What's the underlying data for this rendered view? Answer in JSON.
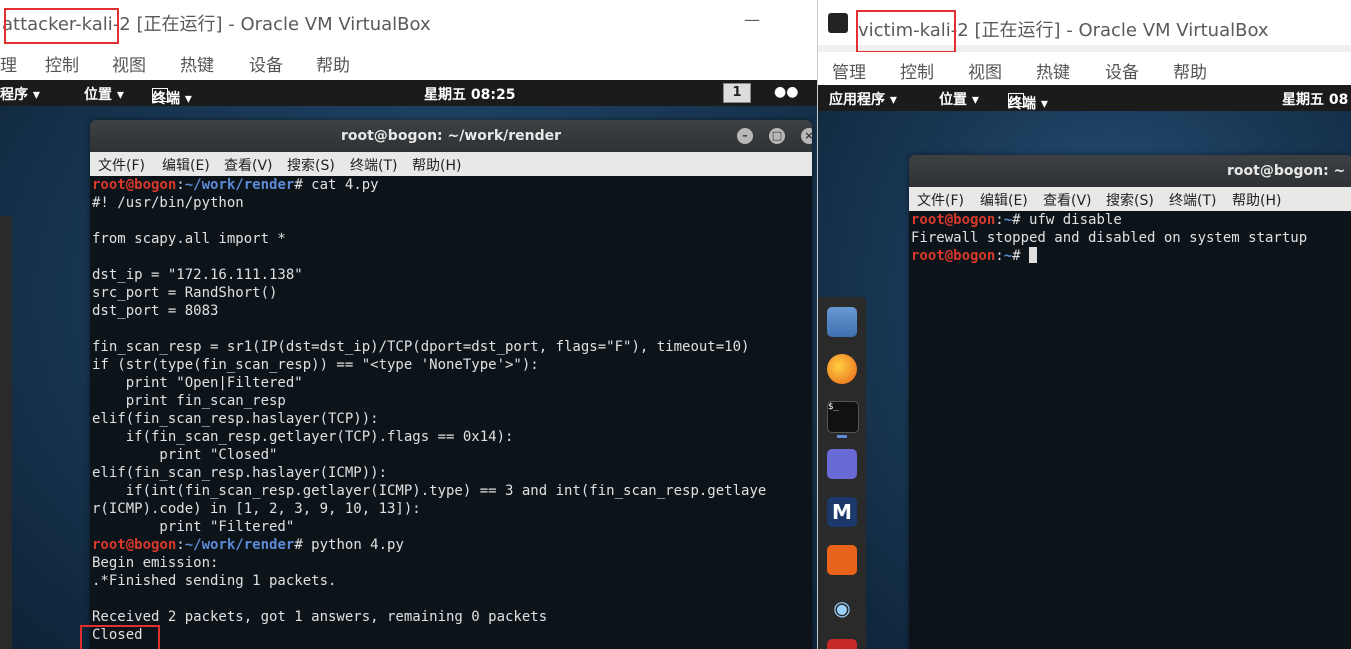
{
  "attacker": {
    "title_name": "attacker-kali-2",
    "title_rest": " [正在运行] - Oracle VM VirtualBox",
    "menu": [
      "理",
      "控制",
      "视图",
      "热键",
      "设备",
      "帮助"
    ],
    "panel": {
      "apps": "程序 ▾",
      "places": "位置 ▾",
      "terminal": "终端 ▾",
      "clock": "星期五 08:25",
      "workspace": "1"
    },
    "terminal": {
      "title": "root@bogon: ~/work/render",
      "menu": [
        "文件(F)",
        "编辑(E)",
        "查看(V)",
        "搜索(S)",
        "终端(T)",
        "帮助(H)"
      ],
      "lines": [
        {
          "prompt": true,
          "user": "root@bogon",
          "path": "~/work/render",
          "cmd": "# cat 4.py"
        },
        {
          "text": "#! /usr/bin/python"
        },
        {
          "text": ""
        },
        {
          "text": "from scapy.all import *"
        },
        {
          "text": ""
        },
        {
          "text": "dst_ip = \"172.16.111.138\""
        },
        {
          "text": "src_port = RandShort()"
        },
        {
          "text": "dst_port = 8083"
        },
        {
          "text": ""
        },
        {
          "text": "fin_scan_resp = sr1(IP(dst=dst_ip)/TCP(dport=dst_port, flags=\"F\"), timeout=10)"
        },
        {
          "text": "if (str(type(fin_scan_resp)) == \"<type 'NoneType'>\"):"
        },
        {
          "text": "    print \"Open|Filtered\""
        },
        {
          "text": "    print fin_scan_resp"
        },
        {
          "text": "elif(fin_scan_resp.haslayer(TCP)):"
        },
        {
          "text": "    if(fin_scan_resp.getlayer(TCP).flags == 0x14):"
        },
        {
          "text": "        print \"Closed\""
        },
        {
          "text": "elif(fin_scan_resp.haslayer(ICMP)):"
        },
        {
          "text": "    if(int(fin_scan_resp.getlayer(ICMP).type) == 3 and int(fin_scan_resp.getlaye"
        },
        {
          "text": "r(ICMP).code) in [1, 2, 3, 9, 10, 13]):"
        },
        {
          "text": "        print \"Filtered\""
        },
        {
          "prompt": true,
          "user": "root@bogon",
          "path": "~/work/render",
          "cmd": "# python 4.py"
        },
        {
          "text": "Begin emission:"
        },
        {
          "text": ".*Finished sending 1 packets."
        },
        {
          "text": ""
        },
        {
          "text": "Received 2 packets, got 1 answers, remaining 0 packets"
        },
        {
          "text": "Closed"
        }
      ]
    }
  },
  "victim": {
    "title_name": "victim-kali-2",
    "title_rest": " [正在运行] - Oracle VM VirtualBox",
    "menu": [
      "管理",
      "控制",
      "视图",
      "热键",
      "设备",
      "帮助"
    ],
    "panel": {
      "apps": "应用程序 ▾",
      "places": "位置 ▾",
      "terminal": "终端 ▾",
      "clock": "星期五 08"
    },
    "terminal": {
      "title": "root@bogon: ~",
      "menu": [
        "文件(F)",
        "编辑(E)",
        "查看(V)",
        "搜索(S)",
        "终端(T)",
        "帮助(H)"
      ],
      "lines": [
        {
          "prompt": true,
          "user": "root@bogon",
          "path": "~",
          "cmd": "# ufw disable"
        },
        {
          "text": "Firewall stopped and disabled on system startup"
        },
        {
          "prompt": true,
          "user": "root@bogon",
          "path": "~",
          "cmd": "# ",
          "cursor": true
        }
      ]
    },
    "dock": [
      "files-icon",
      "firefox-icon",
      "terminal-icon",
      "text-editor-icon",
      "metasploit-icon",
      "burpsuite-icon",
      "eye-icon"
    ]
  },
  "colors": {
    "prompt_user": "#d8392a",
    "prompt_path": "#5d8bd6",
    "highlight_box": "#e03030"
  }
}
